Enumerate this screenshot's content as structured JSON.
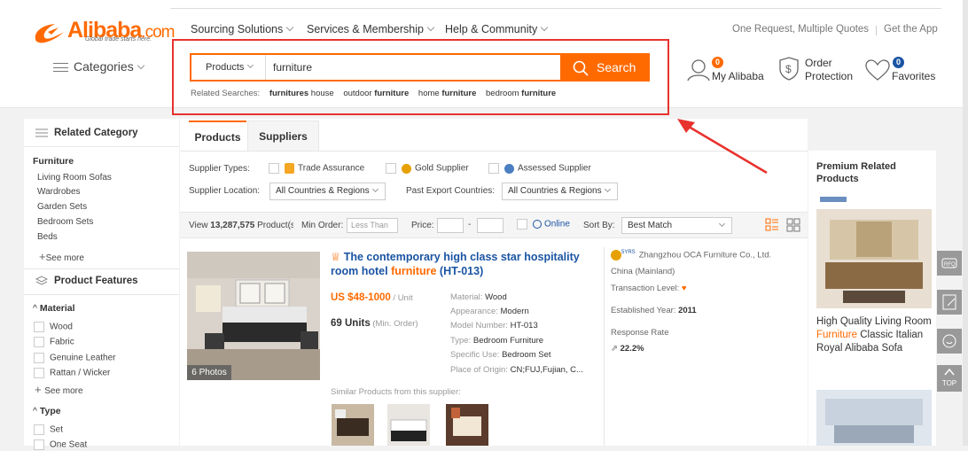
{
  "header": {
    "logo_word": "Alibaba",
    "logo_com": ".com",
    "logo_tagline": "Global trade starts here.",
    "nav": [
      "Sourcing Solutions",
      "Services & Membership",
      "Help & Community"
    ],
    "right_links": [
      "One Request, Multiple Quotes",
      "Get the App"
    ],
    "categories_label": "Categories",
    "my_alibaba": "My Alibaba",
    "my_alibaba_badge": "0",
    "order_protection_line1": "Order",
    "order_protection_line2": "Protection",
    "favorites": "Favorites",
    "favorites_badge": "0"
  },
  "search": {
    "category": "Products",
    "query": "furniture",
    "button_label": "Search",
    "related_label": "Related Searches:",
    "related": [
      {
        "pre": "",
        "bold": "furnitures",
        "post": " house"
      },
      {
        "pre": "outdoor ",
        "bold": "furniture",
        "post": ""
      },
      {
        "pre": "home ",
        "bold": "furniture",
        "post": ""
      },
      {
        "pre": "bedroom ",
        "bold": "furniture",
        "post": ""
      }
    ]
  },
  "sidebar": {
    "related_category": "Related Category",
    "category_title": "Furniture",
    "categories": [
      "Living Room Sofas",
      "Wardrobes",
      "Garden Sets",
      "Bedroom Sets",
      "Beds"
    ],
    "see_more": "See more",
    "product_features": "Product Features",
    "material_title": "Material",
    "materials": [
      "Wood",
      "Fabric",
      "Genuine Leather",
      "Rattan / Wicker"
    ],
    "material_see_more": "See more",
    "type_title": "Type",
    "types": [
      "Set",
      "One Seat"
    ]
  },
  "tabs": [
    "Products",
    "Suppliers"
  ],
  "filters": {
    "supplier_types_label": "Supplier Types:",
    "trade_assurance": "Trade Assurance",
    "gold_supplier": "Gold Supplier",
    "assessed_supplier": "Assessed Supplier",
    "supplier_location_label": "Supplier Location:",
    "supplier_location_value": "All Countries & Regions",
    "past_export_label": "Past Export Countries:",
    "past_export_value": "All Countries & Regions"
  },
  "sortbar": {
    "view_prefix": "View ",
    "view_count": "13,287,575",
    "view_suffix": " Product(s",
    "min_order_label": "Min Order:",
    "min_order_placeholder": "Less Than",
    "price_label": "Price:",
    "price_dash": "-",
    "online_label": "Online",
    "sort_by_label": "Sort By:",
    "sort_by_value": "Best Match"
  },
  "product": {
    "title_pre": "The contemporary high class star hospitality room hotel ",
    "title_hl": "furniture",
    "title_post": " (HT-013)",
    "price": "US $48-1000",
    "price_unit": " / Unit",
    "moq": "69 Units",
    "moq_note": " (Min. Order)",
    "photos": "6 Photos",
    "specs": [
      {
        "label": "Material:",
        "value": "Wood"
      },
      {
        "label": "Appearance:",
        "value": "Modern"
      },
      {
        "label": "Model Number:",
        "value": "HT-013"
      },
      {
        "label": "Type:",
        "value": "Bedroom Furniture"
      },
      {
        "label": "Specific Use:",
        "value": "Bedroom Set"
      },
      {
        "label": "Place of Origin:",
        "value": "CN;FUJ,Fujian, C..."
      }
    ],
    "similar_label": "Similar Products from this supplier:"
  },
  "supplier": {
    "years_badge": "5YRS",
    "name": "Zhangzhou OCA Furniture Co., Ltd.",
    "country": "China (Mainland)",
    "transaction_label": "Transaction Level:",
    "established_label": "Established Year:",
    "established_value": "2011",
    "response_label": "Response Rate",
    "response_value": "22.2%"
  },
  "premium": {
    "title": "Premium Related Products",
    "caption_pre": "High Quality Living Room ",
    "caption_hl": "Furniture",
    "caption_post": " Classic Italian Royal Alibaba Sofa"
  },
  "float_top": "TOP"
}
